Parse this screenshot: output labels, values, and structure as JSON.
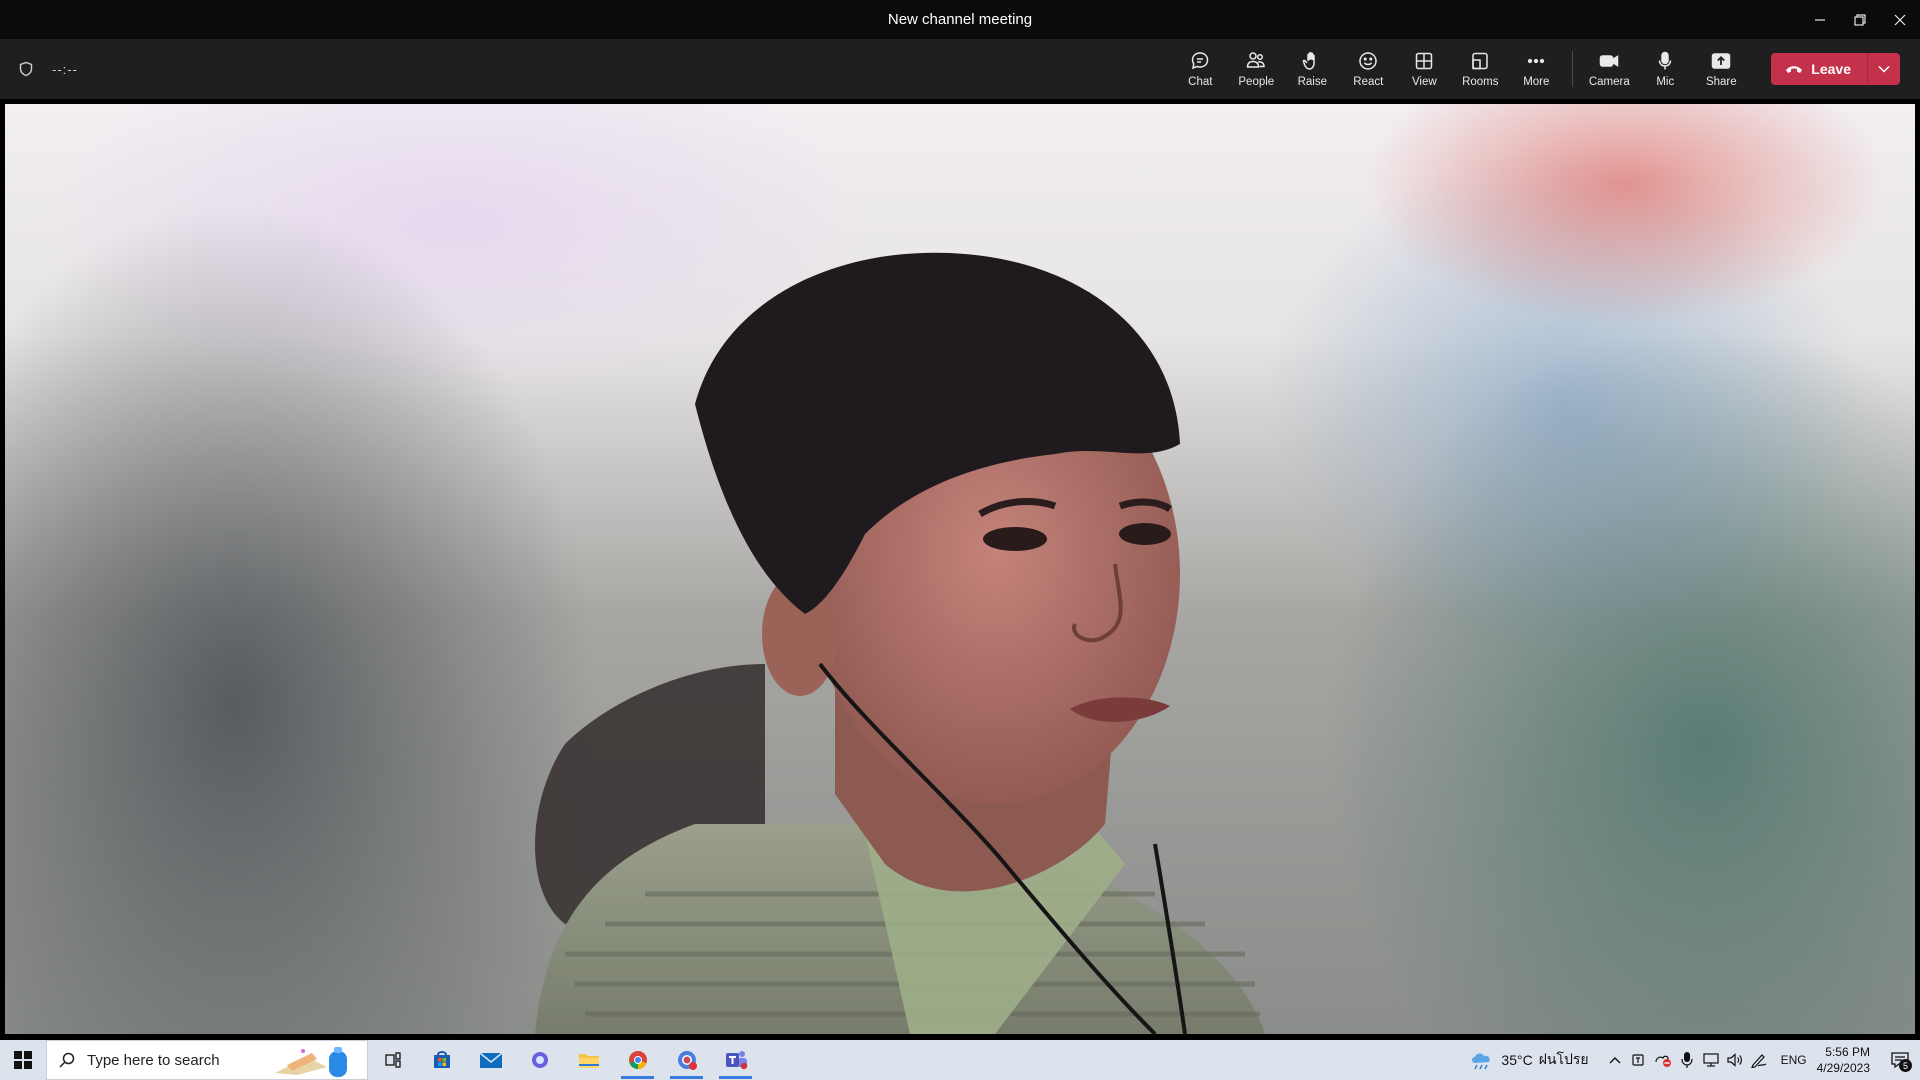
{
  "window": {
    "title": "New channel meeting"
  },
  "toolbar": {
    "timer": "--:--",
    "buttons": [
      {
        "label": "Chat",
        "icon": "chat-icon"
      },
      {
        "label": "People",
        "icon": "people-icon"
      },
      {
        "label": "Raise",
        "icon": "raise-hand-icon"
      },
      {
        "label": "React",
        "icon": "smiley-icon"
      },
      {
        "label": "View",
        "icon": "grid-view-icon"
      },
      {
        "label": "Rooms",
        "icon": "rooms-icon"
      },
      {
        "label": "More",
        "icon": "more-icon"
      }
    ],
    "media_buttons": [
      {
        "label": "Camera",
        "icon": "camera-icon"
      },
      {
        "label": "Mic",
        "icon": "mic-icon"
      },
      {
        "label": "Share",
        "icon": "share-icon"
      }
    ],
    "leave_label": "Leave",
    "leave_color": "#c4314b"
  },
  "taskbar": {
    "search_placeholder": "Type here to search",
    "apps": [
      "task-view-icon",
      "store-icon",
      "mail-icon",
      "copilot-icon",
      "file-explorer-icon",
      "chrome-icon",
      "chrome-profile-icon",
      "teams-icon"
    ],
    "weather": {
      "temp": "35°C",
      "condition": "ฝนโปรย"
    },
    "language": "ENG",
    "time": "5:56 PM",
    "date": "4/29/2023",
    "notifications": "5"
  }
}
